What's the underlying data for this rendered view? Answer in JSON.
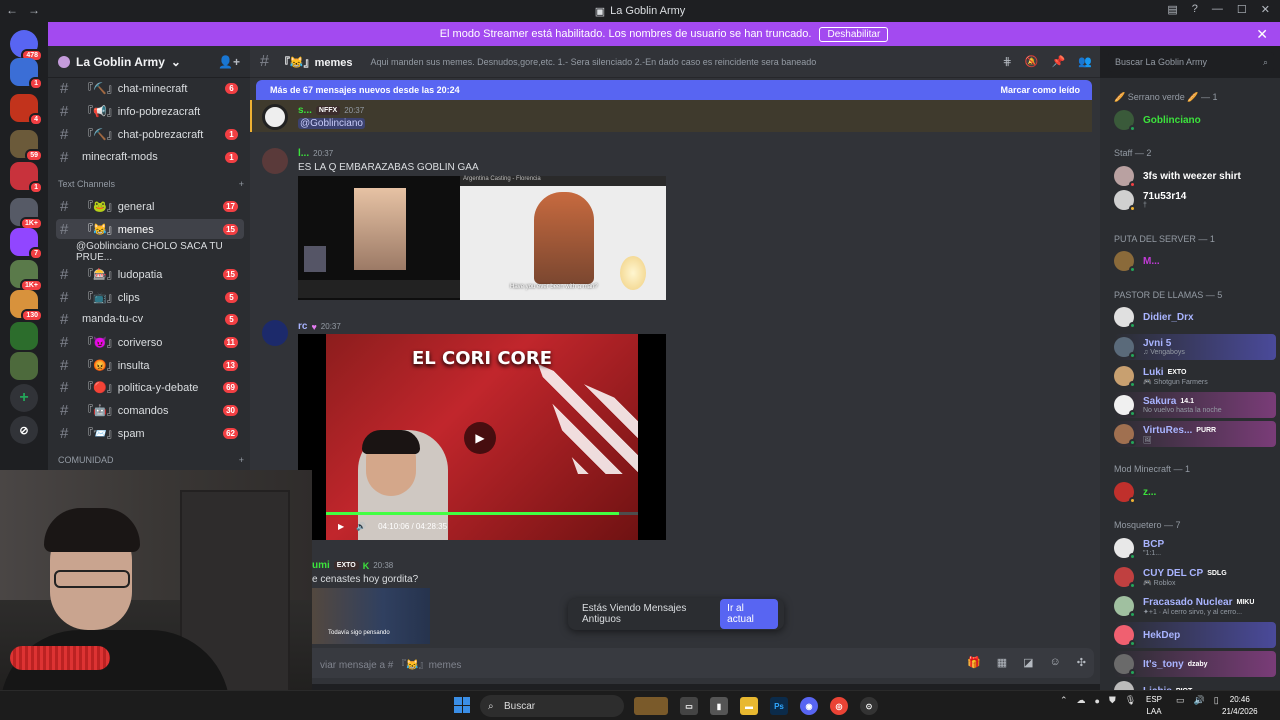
{
  "window": {
    "title": "La Goblin Army"
  },
  "banner": {
    "text": "El modo Streamer está habilitado. Los nombres de usuario se han truncado.",
    "button": "Deshabilitar"
  },
  "servers": [
    {
      "label": "478",
      "color": "#5865f2"
    },
    {
      "label": "1",
      "color": "#3b6ed6"
    },
    {
      "label": "4",
      "color": "#c2331c"
    },
    {
      "label": "59",
      "color": "#6b5a3a"
    },
    {
      "label": "1",
      "color": "#c8323c"
    },
    {
      "label": "1K+",
      "color": "#565a66"
    },
    {
      "label": "7",
      "color": "#9146ff"
    },
    {
      "label": "1K+",
      "color": "#5a7a4a"
    },
    {
      "label": "130",
      "color": "#d8923c"
    },
    {
      "label": "",
      "color": "#2c6d2c"
    },
    {
      "label": "",
      "color": "#4d6a3c"
    }
  ],
  "sidebar": {
    "guild": "La Goblin Army",
    "channels_top": [
      {
        "name": "『⛏️』chat-minecraft",
        "badge": "6"
      },
      {
        "name": "『📢』info-pobrezacraft",
        "badge": ""
      },
      {
        "name": "『⛏️』chat-pobrezacraft",
        "badge": "1"
      },
      {
        "name": "minecraft-mods",
        "badge": "1"
      }
    ],
    "category_text": "Text Channels",
    "channels": [
      {
        "name": "『🐸』general",
        "badge": "17"
      },
      {
        "name": "『😹』memes",
        "badge": "15"
      },
      {
        "name": "@Goblinciano CHOLO SACA TU PRUE...",
        "badge": ""
      },
      {
        "name": "『🎰』ludopatia",
        "badge": "15"
      },
      {
        "name": "『📺』clips",
        "badge": "5"
      },
      {
        "name": "manda-tu-cv",
        "badge": "5"
      },
      {
        "name": "『😈』coriverso",
        "badge": "11"
      },
      {
        "name": "『😡』insulta",
        "badge": "13"
      },
      {
        "name": "『🔴』politica-y-debate",
        "badge": "69"
      },
      {
        "name": "『🤖』comandos",
        "badge": "30"
      },
      {
        "name": "『📨』spam",
        "badge": "62"
      }
    ],
    "category_community": "COMUNIDAD"
  },
  "header": {
    "channel": "『😹』memes",
    "topic": "Aqui manden sus memes. Desnudos,gore,etc. 1.- Sera silenciado 2.-En dado caso es reincidente sera baneado",
    "search_placeholder": "Buscar La Goblin Army"
  },
  "chat": {
    "new_messages": "Más de 67 mensajes nuevos desde las 20:24",
    "mark_read": "Marcar como leído",
    "messages": [
      {
        "author": "s...",
        "tag": "NFFX",
        "time": "20:37",
        "text": "@Goblinciano"
      },
      {
        "author": "l...",
        "tag": "",
        "time": "20:37",
        "text": "ES LA Q EMBARAZABAS GOBLIN GAA",
        "img2_caption": "Have you ever been with a man?",
        "img2_topbar": "Argentina Casting - Florencia"
      },
      {
        "author": "rc",
        "tag": "",
        "time": "20:37",
        "text": "",
        "video_caption": "EL CORI CORE",
        "video_time": "04:10:06 / 04:28:35",
        "video_progress": 0.94
      },
      {
        "author": "umi",
        "tag": "EXTO",
        "time": "20:38",
        "text": "e cenastes hoy gordita?",
        "img3_caption": "Todavía sigo pensando"
      }
    ],
    "old_notice": "Estás Viendo Mensajes Antiguos",
    "jump_button": "Ir al actual",
    "composer_placeholder": "viar mensaje a # 『😹』memes"
  },
  "members": {
    "groups": [
      {
        "title": "🥖 Serrano verde 🥖 — 1"
      },
      {
        "title": "Staff — 2"
      },
      {
        "title": "PUTA DEL SERVER — 1"
      },
      {
        "title": "PASTOR DE LLAMAS — 5"
      },
      {
        "title": "Mod Minecraft — 1"
      },
      {
        "title": "Mosquetero — 7"
      }
    ],
    "list": [
      {
        "name": "Goblinciano",
        "sub": "",
        "tag": "",
        "color": "#3ce23c"
      },
      {
        "name": "3fs with weezer shirt",
        "sub": "",
        "tag": "",
        "color": "#ffffff"
      },
      {
        "name": "71u53r14",
        "sub": "†",
        "tag": "",
        "color": "#ffffff"
      },
      {
        "name": "M...",
        "sub": "",
        "tag": "",
        "color": "#c33bd8"
      },
      {
        "name": "Didier_Drx",
        "sub": "",
        "tag": "",
        "color": "#a9b4ff"
      },
      {
        "name": "Jvni 5",
        "sub": "♫ Vengaboys",
        "tag": "",
        "color": "#a9b4ff"
      },
      {
        "name": "Luki",
        "sub": "🎮 Shotgun Farmers",
        "tag": "EXTO",
        "color": "#a9b4ff"
      },
      {
        "name": "Sakura",
        "sub": "No vuelvo hasta la noche",
        "tag": "14.1",
        "color": "#a9b4ff"
      },
      {
        "name": "VirtuRes...",
        "sub": "🖼",
        "tag": "PURR",
        "color": "#a9b4ff"
      },
      {
        "name": "z...",
        "sub": "",
        "tag": "",
        "color": "#3ce23c"
      },
      {
        "name": "BCP",
        "sub": "\"1:1...",
        "tag": "",
        "color": "#a9b4ff"
      },
      {
        "name": "CUY DEL CP",
        "sub": "🎮 Roblox",
        "tag": "SDLG",
        "color": "#a9b4ff"
      },
      {
        "name": "Fracasado Nuclear",
        "sub": "✦+1 · Al cerro sirvo, y al cerro...",
        "tag": "MIKU",
        "color": "#a9b4ff"
      },
      {
        "name": "HekDep",
        "sub": "",
        "tag": "",
        "color": "#a9b4ff"
      },
      {
        "name": "It's_tony",
        "sub": "",
        "tag": "dzaby",
        "color": "#a9b4ff"
      },
      {
        "name": "Lichis",
        "sub": "",
        "tag": "PIOT",
        "color": "#a9b4ff"
      }
    ]
  },
  "taskbar": {
    "search": "Buscar",
    "lang": "ESP",
    "lang2": "LAA",
    "time": "20:46",
    "date": "21/4/2026"
  }
}
